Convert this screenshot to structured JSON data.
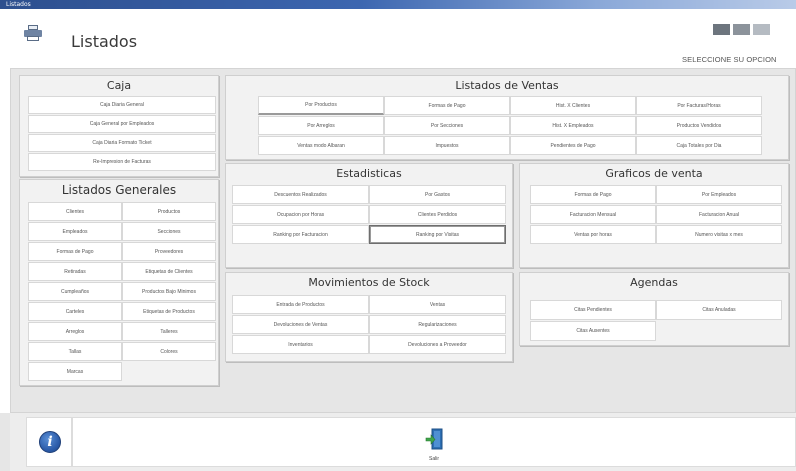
{
  "window": {
    "caption": "Listados"
  },
  "header": {
    "title": "Listados",
    "prompt": "SELECCIONE SU OPCION"
  },
  "caja": {
    "title": "Caja",
    "buttons": [
      "Caja Diaria General",
      "Caja General por Empleados",
      "Caja Diaria Formato Ticket",
      "Re-Impresion de Facturas"
    ]
  },
  "generales": {
    "title": "Listados Generales",
    "buttons": [
      "Clientes",
      "Productos",
      "Empleados",
      "Secciones",
      "Formas de Pago",
      "Proveedores",
      "Retiradas",
      "Etiquetas de Clientes",
      "Cumpleaños",
      "Productos Bajo Minimos",
      "Carteles",
      "Etiquetas de Productos",
      "Arreglos",
      "Talleres",
      "Tallas",
      "Colores",
      "Marcas"
    ]
  },
  "ventas": {
    "title": "Listados de Ventas",
    "buttons": [
      "Por Productos",
      "Formas de Pago",
      "Hist. X Clientes",
      "Por Facturas/Horas",
      "Por Arreglos",
      "Por Secciones",
      "Hist. X Empleados",
      "Productos Vendidos",
      "Ventas modo Albaran",
      "Impuestos",
      "Pendientes de Pago",
      "Caja Totales por Dia"
    ]
  },
  "estadisticas": {
    "title": "Estadisticas",
    "buttons": [
      "Descuentos Realizados",
      "Por Gastos",
      "Ocupacion por Horas",
      "Clientes Perdidos",
      "Ranking por Facturacion",
      "Ranking por Visitas"
    ]
  },
  "graficos": {
    "title": "Graficos de venta",
    "buttons": [
      "Formas de Pago",
      "Por Empleados",
      "Facturacion Mensual",
      "Facturacion Anual",
      "Ventas por horas",
      "Numero visitas x mes"
    ]
  },
  "stock": {
    "title": "Movimientos de Stock",
    "buttons": [
      "Entrada de Productos",
      "Ventas",
      "Devoluciones de Ventas",
      "Regularizaciones",
      "Inventarios",
      "Devoluciones a Proveedor"
    ]
  },
  "agendas": {
    "title": "Agendas",
    "buttons": [
      "Citas Pendientes",
      "Citas Anuladas",
      "Citas Ausentes"
    ]
  },
  "footer": {
    "exit_label": "Salir"
  },
  "icons": {
    "app": "printer-icon",
    "info": "info-icon",
    "exit": "exit-door-icon"
  },
  "colors": {
    "accent": "#2a5aa8",
    "panel": "#f2f2f2",
    "background": "#e6e6e6",
    "exit_arrow": "#3fa54a"
  }
}
